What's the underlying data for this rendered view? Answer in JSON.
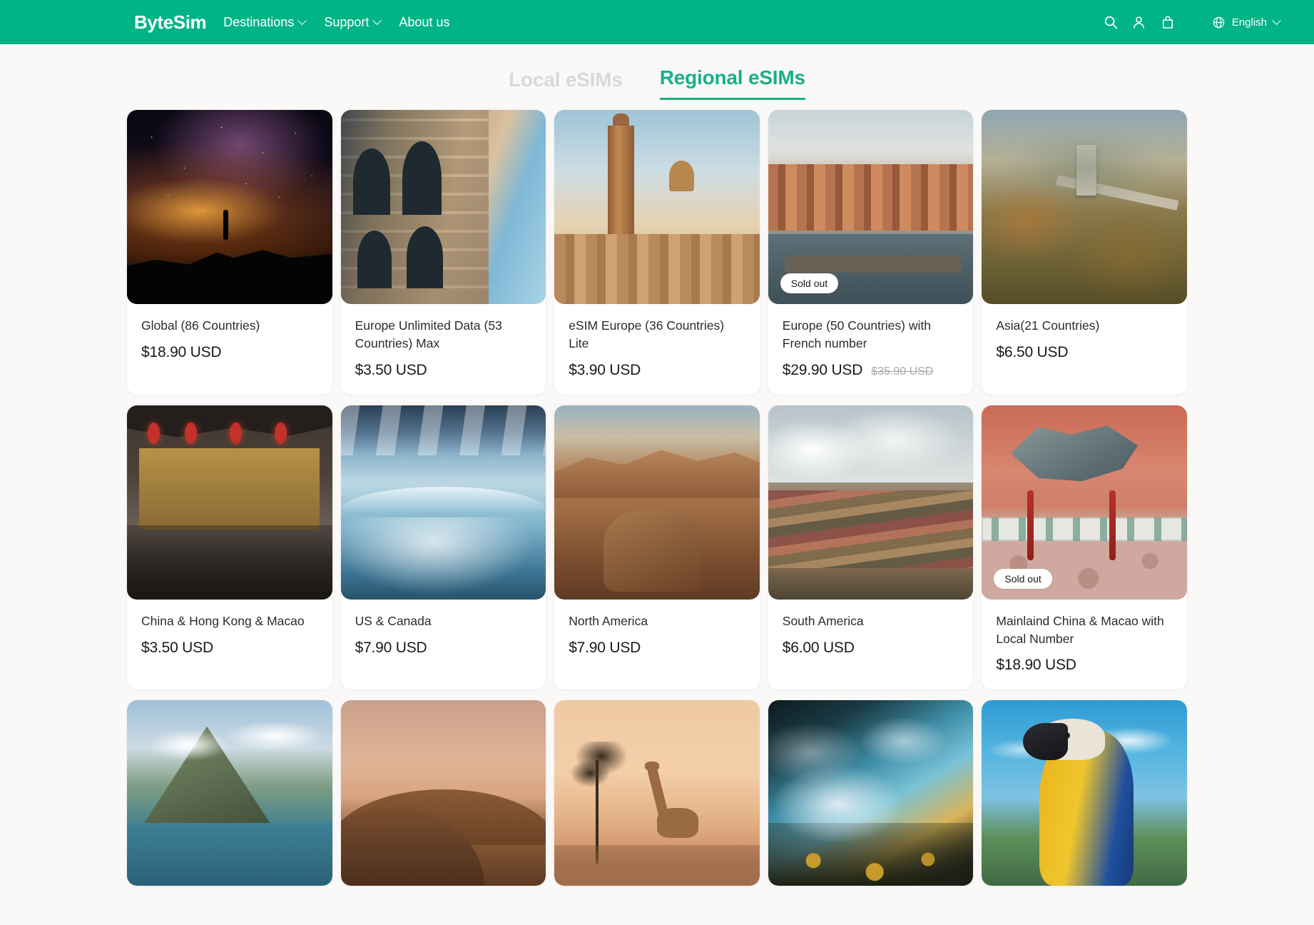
{
  "header": {
    "logo": "ByteSim",
    "nav": [
      {
        "label": "Destinations",
        "has_chevron": true
      },
      {
        "label": "Support",
        "has_chevron": true
      },
      {
        "label": "About us",
        "has_chevron": false
      }
    ],
    "icons": [
      "search-icon",
      "account-icon",
      "cart-icon"
    ],
    "language": "English",
    "brand_color": "#00b488"
  },
  "tabs": [
    {
      "label": "Local eSIMs",
      "active": false
    },
    {
      "label": "Regional eSIMs",
      "active": true
    }
  ],
  "tab_active_color": "#15b187",
  "tab_inactive_color": "#d4dbd9",
  "products": [
    {
      "title": "Global (86 Countries)",
      "price": "$18.90 USD",
      "compare_at": "",
      "badge": "",
      "art": "img-galaxy"
    },
    {
      "title": "Europe Unlimited Data (53 Countries) Max",
      "price": "$3.50 USD",
      "compare_at": "",
      "badge": "",
      "art": "img-colosseum"
    },
    {
      "title": "eSIM Europe (36 Countries) Lite",
      "price": "$3.90 USD",
      "compare_at": "",
      "badge": "",
      "art": "img-seville"
    },
    {
      "title": "Europe (50 Countries) with French number",
      "price": "$29.90 USD",
      "compare_at": "$35.90 USD",
      "badge": "Sold out",
      "art": "img-prague"
    },
    {
      "title": "Asia(21 Countries)",
      "price": "$6.50 USD",
      "compare_at": "",
      "badge": "",
      "art": "img-wall"
    },
    {
      "title": "China & Hong Kong & Macao",
      "price": "$3.50 USD",
      "compare_at": "",
      "badge": "",
      "art": "img-lantern"
    },
    {
      "title": "US & Canada",
      "price": "$7.90 USD",
      "compare_at": "",
      "badge": "",
      "art": "img-falls"
    },
    {
      "title": "North America",
      "price": "$7.90 USD",
      "compare_at": "",
      "badge": "",
      "art": "img-canyon"
    },
    {
      "title": "South America",
      "price": "$6.00 USD",
      "compare_at": "",
      "badge": "",
      "art": "img-rainbow"
    },
    {
      "title": "Mainlaind China & Macao with Local Number",
      "price": "$18.90 USD",
      "compare_at": "",
      "badge": "Sold out",
      "art": "img-dragon"
    }
  ],
  "partial_row": [
    {
      "art": "img-island"
    },
    {
      "art": "img-dunes"
    },
    {
      "art": "img-savanna"
    },
    {
      "art": "img-ocean"
    },
    {
      "art": "img-parrot"
    }
  ]
}
